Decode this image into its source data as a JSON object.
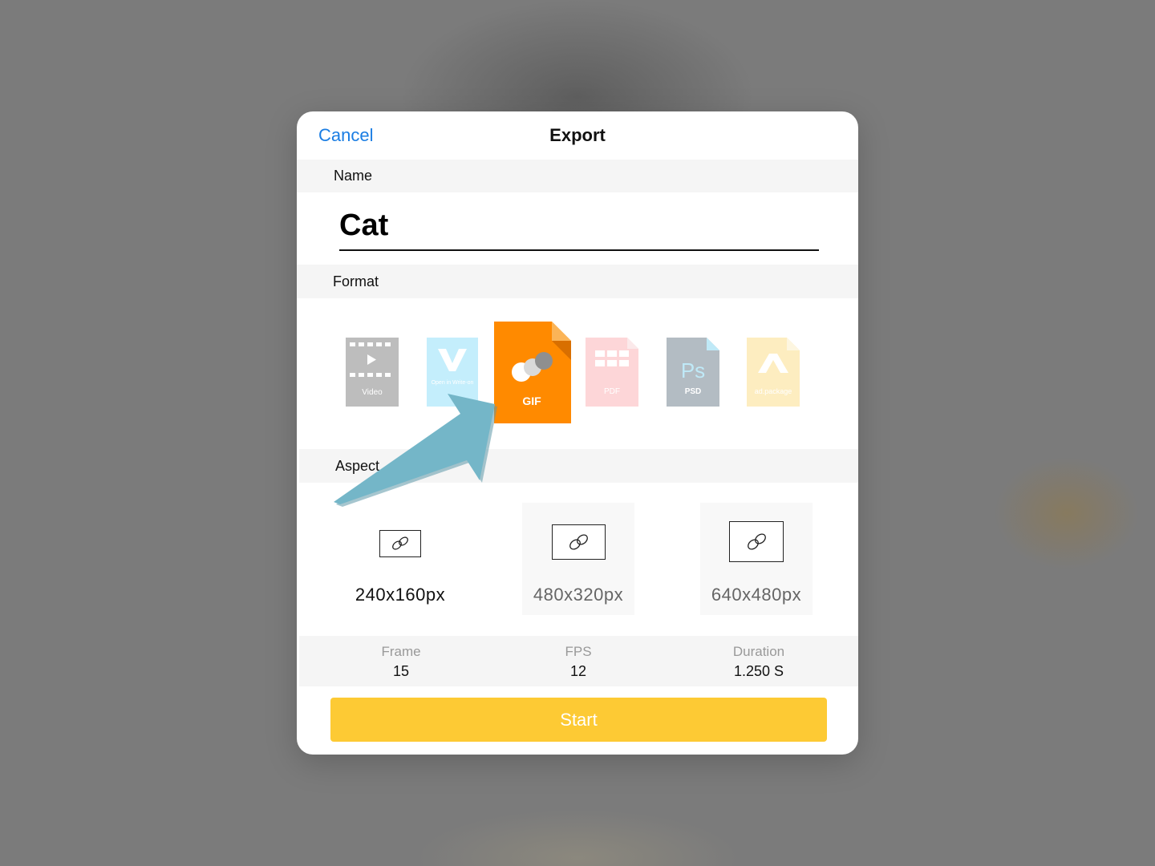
{
  "dialog": {
    "cancel_label": "Cancel",
    "title": "Export"
  },
  "name_section": {
    "label": "Name",
    "value": "Cat"
  },
  "format_section": {
    "label": "Format",
    "formats": [
      {
        "label": "Video",
        "icon": "video-file-icon",
        "color": "#bdbdbd",
        "selected": false
      },
      {
        "label": "Open in Write-on",
        "icon": "write-on-file-icon",
        "color": "#c4eefc",
        "selected": false
      },
      {
        "label": "GIF",
        "icon": "gif-file-icon",
        "color": "#ff8a00",
        "selected": true
      },
      {
        "label": "PDF",
        "icon": "pdf-file-icon",
        "color": "#fdd6d8",
        "selected": false
      },
      {
        "label": "PSD",
        "icon": "psd-file-icon",
        "color": "#b3bcc3",
        "selected": false
      },
      {
        "label": "ad.package",
        "icon": "package-file-icon",
        "color": "#fdedc0",
        "selected": false
      }
    ]
  },
  "aspect_section": {
    "label": "Aspect",
    "sizes": [
      {
        "label": "240x160px",
        "selected": true
      },
      {
        "label": "480x320px",
        "selected": false
      },
      {
        "label": "640x480px",
        "selected": false
      }
    ]
  },
  "stats": {
    "frame_label": "Frame",
    "frame_value": "15",
    "fps_label": "FPS",
    "fps_value": "12",
    "duration_label": "Duration",
    "duration_value": "1.250 S"
  },
  "start_label": "Start",
  "colors": {
    "accent_blue": "#1a7de3",
    "start_yellow": "#fdca34",
    "gif_orange": "#ff8a00",
    "annotation_arrow": "#74b6c8"
  }
}
